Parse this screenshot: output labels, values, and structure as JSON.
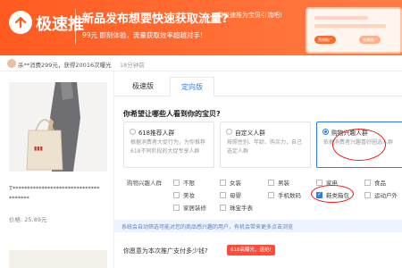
{
  "banner": {
    "brand": "极速推",
    "headline": "新品发布想要快速获取流量?",
    "tagline": "用极速推为宝贝引流吧!",
    "subline_prefix": "99元 即刻体验，流量获取效率超越对手!",
    "screen_pill_1": "营销推广",
    "screen_pill_2": "普通推广"
  },
  "stats": {
    "text": "杀**消费299元，获得20016次曝光",
    "time": "18分钟前"
  },
  "product": {
    "title": "T******************************",
    "title_line2": "*******",
    "price": "价格: 25.89元"
  },
  "tabs": {
    "items": [
      {
        "label": "极速版"
      },
      {
        "label": "定向版"
      }
    ]
  },
  "targeting": {
    "question": "你希望让哪些人看到你的宝贝?",
    "cards": [
      {
        "title": "618推荐人群",
        "desc": "根据消费者大促行为，为你推荐618不同阶段的大促专享人群"
      },
      {
        "title": "自定义人群",
        "desc": "按照性别、年龄、购买力，自己选定人群"
      },
      {
        "title": "购物兴趣人群",
        "desc": "依据消费者兴趣喜好圈选人群"
      }
    ],
    "interest_label": "购物兴趣人群",
    "interests": [
      {
        "label": "不限",
        "checked": false
      },
      {
        "label": "女装",
        "checked": false
      },
      {
        "label": "男装",
        "checked": false
      },
      {
        "label": "家电",
        "checked": false
      },
      {
        "label": "食品",
        "checked": false
      },
      {
        "label": "美妆",
        "checked": false
      },
      {
        "label": "母婴",
        "checked": false
      },
      {
        "label": "手机数码",
        "checked": false
      },
      {
        "label": "鞋类箱包",
        "checked": true
      },
      {
        "label": "运动户外",
        "checked": false
      },
      {
        "label": "家居装修",
        "checked": false
      },
      {
        "label": "珠宝手表",
        "checked": false
      }
    ],
    "notice": "系统会自动筛选可能对您的商品感兴趣的用户，有机会带来更多点击浏览"
  },
  "budget": {
    "question": "你愿意为本次推广支付多少钱?",
    "badge": "618高曝光，速抢!"
  },
  "colors": {
    "banner_orange": "#ff5a1f",
    "accent_blue": "#2d7de5",
    "highlight_red": "#e61e1e"
  }
}
